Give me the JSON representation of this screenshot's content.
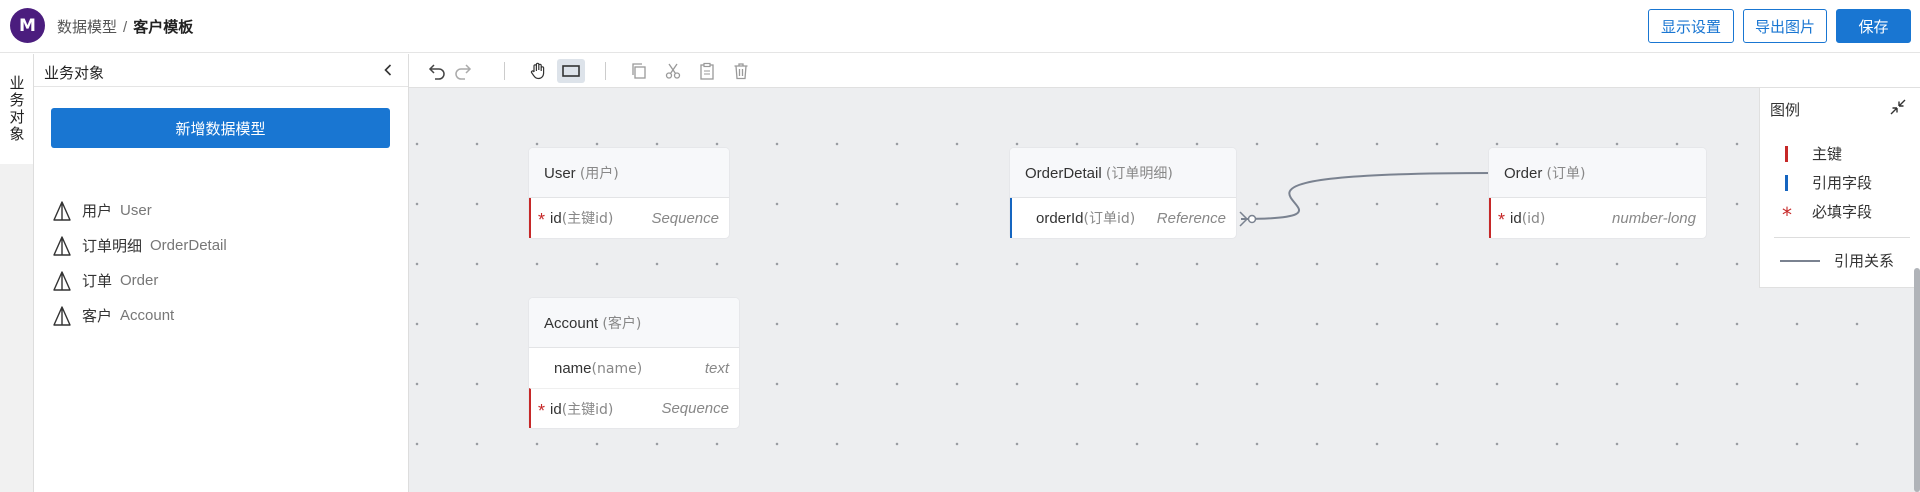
{
  "header": {
    "logo_letter": "M",
    "breadcrumb": [
      "数据模型",
      "客户模板"
    ],
    "separator": "/",
    "buttons": {
      "display_settings": "显示设置",
      "export_image": "导出图片",
      "save": "保存"
    }
  },
  "side_tab": {
    "label": "业务对象"
  },
  "sidebar": {
    "title": "业务对象",
    "add_button": "新增数据模型",
    "models": [
      {
        "cn": "用户",
        "en": "User"
      },
      {
        "cn": "订单明细",
        "en": "OrderDetail"
      },
      {
        "cn": "订单",
        "en": "Order"
      },
      {
        "cn": "客户",
        "en": "Account"
      }
    ]
  },
  "toolbar": {
    "icons": [
      "undo-icon",
      "redo-icon",
      "hand-icon",
      "select-rect-icon",
      "copy-icon",
      "cut-icon",
      "paste-icon",
      "delete-icon"
    ],
    "active": "select-rect-icon"
  },
  "entities": {
    "user": {
      "name": "User",
      "cn": "(用户)",
      "fields": [
        {
          "name": "id",
          "cn": "(主键id)",
          "type": "Sequence",
          "kind": "pk",
          "required": true
        }
      ]
    },
    "order_detail": {
      "name": "OrderDetail",
      "cn": "(订单明细)",
      "fields": [
        {
          "name": "orderId",
          "cn": "(订单id)",
          "type": "Reference",
          "kind": "ref",
          "required": false
        }
      ]
    },
    "order": {
      "name": "Order",
      "cn": "(订单)",
      "fields": [
        {
          "name": "id",
          "cn": "(id)",
          "type": "number-long",
          "kind": "pk",
          "required": true
        }
      ]
    },
    "account": {
      "name": "Account",
      "cn": "(客户)",
      "fields": [
        {
          "name": "name",
          "cn": "(name)",
          "type": "text",
          "kind": "normal",
          "required": false
        },
        {
          "name": "id",
          "cn": "(主键id)",
          "type": "Sequence",
          "kind": "pk",
          "required": true
        }
      ]
    }
  },
  "legend": {
    "title": "图例",
    "items": {
      "primary_key": "主键",
      "reference_field": "引用字段",
      "required_field": "必填字段",
      "relation": "引用关系"
    },
    "colors": {
      "primary_key": "#c62828",
      "reference": "#1565c0",
      "required": "#c62828",
      "relation": "#7a8290"
    }
  },
  "colors": {
    "accent": "#1976d2",
    "logo": "#4b1d7e"
  }
}
